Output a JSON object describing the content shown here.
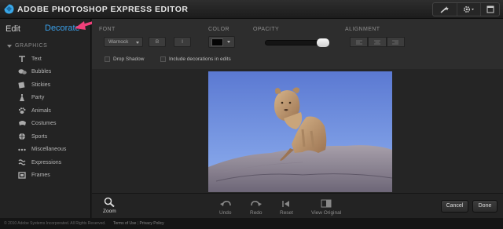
{
  "app": {
    "title": "ADOBE PHOTOSHOP EXPRESS EDITOR",
    "logo_icon": "photoshop-express-logo-icon"
  },
  "titlebar": {
    "icons": [
      "magic-wand-icon",
      "gear-icon",
      "window-icon"
    ]
  },
  "sidebar": {
    "edit_tab": "Edit",
    "decorate_tab": "Decorate",
    "annotation_color": "#f0407a",
    "section": "GRAPHICS",
    "items": [
      {
        "label": "Text",
        "icon": "text-icon"
      },
      {
        "label": "Bubbles",
        "icon": "bubbles-icon"
      },
      {
        "label": "Stickies",
        "icon": "stickies-icon"
      },
      {
        "label": "Party",
        "icon": "party-icon"
      },
      {
        "label": "Animals",
        "icon": "paw-icon"
      },
      {
        "label": "Costumes",
        "icon": "costumes-icon"
      },
      {
        "label": "Sports",
        "icon": "sports-icon"
      },
      {
        "label": "Miscellaneous",
        "icon": "miscellaneous-icon"
      },
      {
        "label": "Expressions",
        "icon": "expressions-icon"
      },
      {
        "label": "Frames",
        "icon": "frames-icon"
      }
    ]
  },
  "toolbar": {
    "font_label": "FONT",
    "font_value": "Warnock",
    "bold_label": "B",
    "italic_label": "I",
    "color_label": "COLOR",
    "color_value": "#050505",
    "opacity_label": "OPACITY",
    "opacity_value": 100,
    "alignment_label": "ALIGNMENT",
    "drop_shadow_label": "Drop Shadow",
    "include_decorations_label": "Include decorations in edits"
  },
  "canvas": {
    "image_description_icon": "photo-canvas"
  },
  "bottombar": {
    "zoom": "Zoom",
    "undo": "Undo",
    "redo": "Redo",
    "reset": "Reset",
    "view_original": "View Original",
    "cancel": "Cancel",
    "done": "Done"
  },
  "footer": {
    "copyright": "© 2010 Adobe Systems Incorporated. All Rights Reserved.",
    "terms": "Terms of Use",
    "privacy": "Privacy Policy"
  }
}
